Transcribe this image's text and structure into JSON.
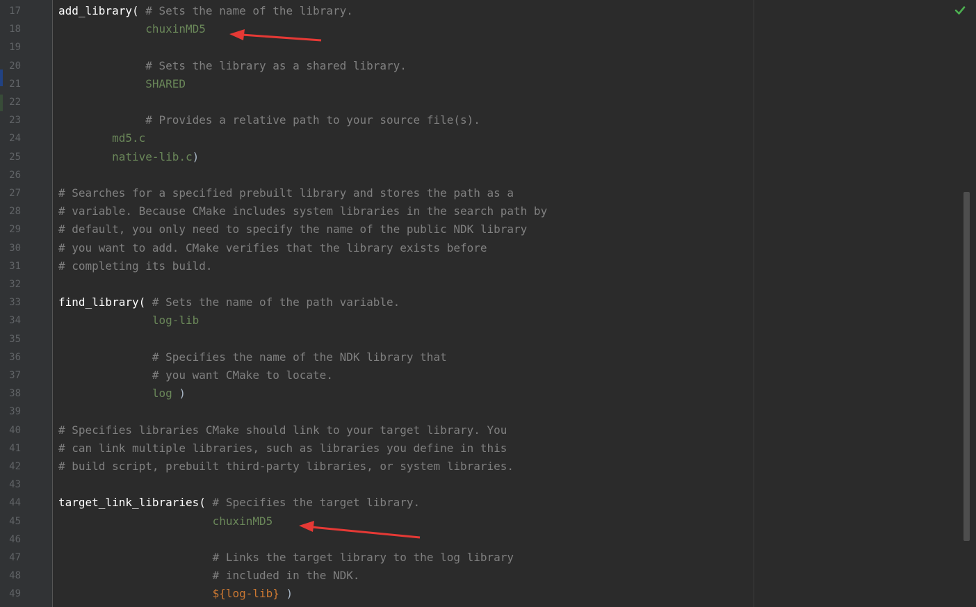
{
  "editor": {
    "colors": {
      "background": "#2b2b2b",
      "gutter": "#313335",
      "line_number": "#606366",
      "function": "#ffffff",
      "comment": "#808080",
      "string": "#6a8759",
      "variable": "#cc7832",
      "arrow": "#e53935",
      "check": "#4caf50"
    },
    "status_icon": "check-icon",
    "lines": [
      {
        "no": "17",
        "tokens": [
          {
            "t": "fn",
            "v": "add_library("
          },
          {
            "t": "comment",
            "v": " # Sets the name of the library."
          }
        ]
      },
      {
        "no": "18",
        "tokens": [
          {
            "t": "ws",
            "v": "             "
          },
          {
            "t": "str",
            "v": "chuxinMD5"
          }
        ]
      },
      {
        "no": "19",
        "tokens": []
      },
      {
        "no": "20",
        "tokens": [
          {
            "t": "ws",
            "v": "             "
          },
          {
            "t": "comment",
            "v": "# Sets the library as a shared library."
          }
        ]
      },
      {
        "no": "21",
        "tokens": [
          {
            "t": "ws",
            "v": "             "
          },
          {
            "t": "str",
            "v": "SHARED"
          }
        ]
      },
      {
        "no": "22",
        "tokens": []
      },
      {
        "no": "23",
        "tokens": [
          {
            "t": "ws",
            "v": "             "
          },
          {
            "t": "comment",
            "v": "# Provides a relative path to your source file(s)."
          }
        ]
      },
      {
        "no": "24",
        "tokens": [
          {
            "t": "ws",
            "v": "        "
          },
          {
            "t": "str",
            "v": "md5.c"
          }
        ]
      },
      {
        "no": "25",
        "tokens": [
          {
            "t": "ws",
            "v": "        "
          },
          {
            "t": "str",
            "v": "native-lib.c"
          },
          {
            "t": "paren",
            "v": ")"
          }
        ]
      },
      {
        "no": "26",
        "tokens": []
      },
      {
        "no": "27",
        "tokens": [
          {
            "t": "comment",
            "v": "# Searches for a specified prebuilt library and stores the path as a"
          }
        ]
      },
      {
        "no": "28",
        "tokens": [
          {
            "t": "comment",
            "v": "# variable. Because CMake includes system libraries in the search path by"
          }
        ]
      },
      {
        "no": "29",
        "tokens": [
          {
            "t": "comment",
            "v": "# default, you only need to specify the name of the public NDK library"
          }
        ]
      },
      {
        "no": "30",
        "tokens": [
          {
            "t": "comment",
            "v": "# you want to add. CMake verifies that the library exists before"
          }
        ]
      },
      {
        "no": "31",
        "tokens": [
          {
            "t": "comment",
            "v": "# completing its build."
          }
        ]
      },
      {
        "no": "32",
        "tokens": []
      },
      {
        "no": "33",
        "tokens": [
          {
            "t": "fn",
            "v": "find_library("
          },
          {
            "t": "comment",
            "v": " # Sets the name of the path variable."
          }
        ]
      },
      {
        "no": "34",
        "tokens": [
          {
            "t": "ws",
            "v": "              "
          },
          {
            "t": "str",
            "v": "log-lib"
          }
        ]
      },
      {
        "no": "35",
        "tokens": []
      },
      {
        "no": "36",
        "tokens": [
          {
            "t": "ws",
            "v": "              "
          },
          {
            "t": "comment",
            "v": "# Specifies the name of the NDK library that"
          }
        ]
      },
      {
        "no": "37",
        "tokens": [
          {
            "t": "ws",
            "v": "              "
          },
          {
            "t": "comment",
            "v": "# you want CMake to locate."
          }
        ]
      },
      {
        "no": "38",
        "tokens": [
          {
            "t": "ws",
            "v": "              "
          },
          {
            "t": "str",
            "v": "log"
          },
          {
            "t": "paren",
            "v": " )"
          }
        ]
      },
      {
        "no": "39",
        "tokens": []
      },
      {
        "no": "40",
        "tokens": [
          {
            "t": "comment",
            "v": "# Specifies libraries CMake should link to your target library. You"
          }
        ]
      },
      {
        "no": "41",
        "tokens": [
          {
            "t": "comment",
            "v": "# can link multiple libraries, such as libraries you define in this"
          }
        ]
      },
      {
        "no": "42",
        "tokens": [
          {
            "t": "comment",
            "v": "# build script, prebuilt third-party libraries, or system libraries."
          }
        ]
      },
      {
        "no": "43",
        "tokens": []
      },
      {
        "no": "44",
        "tokens": [
          {
            "t": "fn",
            "v": "target_link_libraries("
          },
          {
            "t": "comment",
            "v": " # Specifies the target library."
          }
        ]
      },
      {
        "no": "45",
        "tokens": [
          {
            "t": "ws",
            "v": "                       "
          },
          {
            "t": "str",
            "v": "chuxinMD5"
          }
        ]
      },
      {
        "no": "46",
        "tokens": []
      },
      {
        "no": "47",
        "tokens": [
          {
            "t": "ws",
            "v": "                       "
          },
          {
            "t": "comment",
            "v": "# Links the target library to the log library"
          }
        ]
      },
      {
        "no": "48",
        "tokens": [
          {
            "t": "ws",
            "v": "                       "
          },
          {
            "t": "comment",
            "v": "# included in the NDK."
          }
        ]
      },
      {
        "no": "49",
        "tokens": [
          {
            "t": "ws",
            "v": "                       "
          },
          {
            "t": "var",
            "v": "${log-lib}"
          },
          {
            "t": "paren",
            "v": " )"
          }
        ]
      }
    ]
  }
}
